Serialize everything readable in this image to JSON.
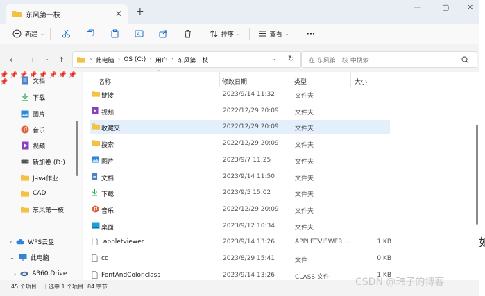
{
  "window": {
    "tab_title": "东风第一枝",
    "new_tab": "+",
    "controls": {
      "minimize": "—",
      "maximize": "▢",
      "close": "✕"
    }
  },
  "toolbar": {
    "new_label": "新建",
    "sort_label": "排序",
    "view_label": "查看",
    "more_label": "···"
  },
  "address": {
    "crumbs": [
      "此电脑",
      "OS (C:)",
      "用户",
      "东风第一枝"
    ],
    "search_placeholder": "在 东风第一枝 中搜索"
  },
  "nav": {
    "items": [
      {
        "label": "文档",
        "icon": "document-icon",
        "color": "#4f7fc9"
      },
      {
        "label": "下载",
        "icon": "download-icon",
        "color": "#2ea44f"
      },
      {
        "label": "图片",
        "icon": "picture-icon",
        "color": "#2f86d8"
      },
      {
        "label": "音乐",
        "icon": "music-icon",
        "color": "#e0603c"
      },
      {
        "label": "视频",
        "icon": "video-icon",
        "color": "#8a3fbf"
      },
      {
        "label": "新加卷 (D:)",
        "icon": "drive-icon",
        "color": "#555555"
      },
      {
        "label": "Java作业",
        "icon": "folder-icon",
        "color": "#f3c244"
      },
      {
        "label": "CAD",
        "icon": "folder-icon",
        "color": "#f3c244"
      },
      {
        "label": "东风第一枝",
        "icon": "folder-icon",
        "color": "#f3c244"
      }
    ],
    "tree": [
      {
        "label": "WPS云盘",
        "icon": "cloud-icon"
      },
      {
        "label": "此电脑",
        "icon": "computer-icon"
      },
      {
        "label": "A360 Drive",
        "icon": "a360-icon"
      }
    ]
  },
  "columns": {
    "name": "名称",
    "date": "修改日期",
    "type": "类型",
    "size": "大小"
  },
  "files": [
    {
      "name": "链接",
      "date": "2023/9/14 11:32",
      "type": "文件夹",
      "size": "",
      "icon": "folder-icon"
    },
    {
      "name": "视频",
      "date": "2022/12/29 20:09",
      "type": "文件夹",
      "size": "",
      "icon": "video-icon"
    },
    {
      "name": "收藏夹",
      "date": "2022/12/29 20:09",
      "type": "文件夹",
      "size": "",
      "icon": "folder-icon"
    },
    {
      "name": "搜索",
      "date": "2022/12/29 20:09",
      "type": "文件夹",
      "size": "",
      "icon": "folder-icon"
    },
    {
      "name": "图片",
      "date": "2023/9/7 11:25",
      "type": "文件夹",
      "size": "",
      "icon": "picture-icon"
    },
    {
      "name": "文档",
      "date": "2023/9/14 11:50",
      "type": "文件夹",
      "size": "",
      "icon": "document-icon"
    },
    {
      "name": "下载",
      "date": "2023/9/5 15:02",
      "type": "文件夹",
      "size": "",
      "icon": "download-icon"
    },
    {
      "name": "音乐",
      "date": "2022/12/29 20:09",
      "type": "文件夹",
      "size": "",
      "icon": "music-icon"
    },
    {
      "name": "桌面",
      "date": "2023/9/12 10:34",
      "type": "文件夹",
      "size": "",
      "icon": "desktop-icon"
    },
    {
      "name": ".appletviewer",
      "date": "2023/9/14 13:26",
      "type": "APPLETVIEWER ...",
      "size": "1 KB",
      "icon": "file-icon"
    },
    {
      "name": "cd",
      "date": "2023/8/29 15:41",
      "type": "文件",
      "size": "0 KB",
      "icon": "file-icon"
    },
    {
      "name": "FontAndColor.class",
      "date": "2023/9/14 13:26",
      "type": "CLASS 文件",
      "size": "1 KB",
      "icon": "file-icon"
    }
  ],
  "status": {
    "count": "45 个项目",
    "selected": "选中 1 个项目",
    "size": "84 字节"
  },
  "watermark": "CSDN @玮子的博客",
  "edge_char": "如",
  "colors": {
    "folder": "#f3c244",
    "selection": "#e3effa",
    "accent": "#0067c0"
  }
}
